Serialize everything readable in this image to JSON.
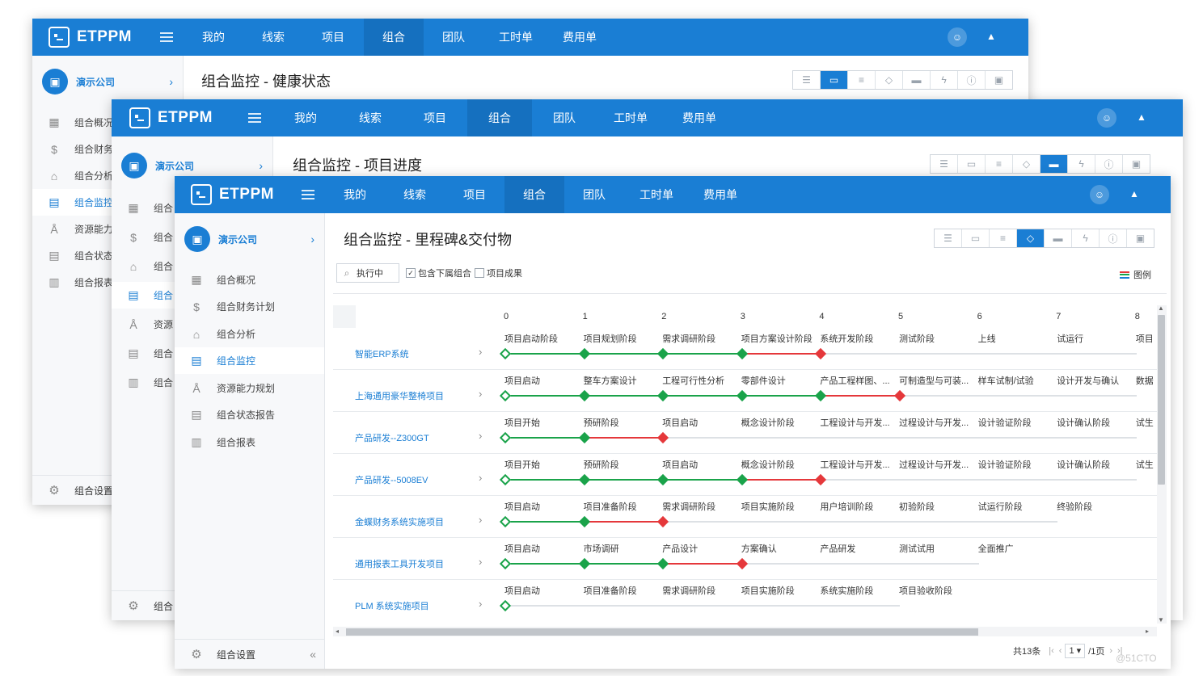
{
  "app": {
    "logo_text": "ETPPM",
    "nav": [
      "我的",
      "线索",
      "项目",
      "组合",
      "团队",
      "工时单",
      "费用单"
    ],
    "active_nav": "组合",
    "company": "演示公司"
  },
  "windows": {
    "back": {
      "title": "组合监控 - 健康状态",
      "sidebar": [
        "组合概况",
        "组合财务计划",
        "组合分析",
        "组合监控",
        "资源能力规划",
        "组合状态报告",
        "组合报表"
      ],
      "sidebar_visible": [
        "组合概况",
        "组合财务",
        "组合分析",
        "组合监控",
        "资源能力",
        "组合状态",
        "组合报表"
      ],
      "footer": "组合设置"
    },
    "middle": {
      "title": "组合监控 - 项目进度",
      "sidebar_visible": [
        "组合",
        "组合",
        "组合",
        "组合",
        "资源",
        "组合",
        "组合"
      ],
      "footer": "组合"
    },
    "front": {
      "title": "组合监控 - 里程碑&交付物",
      "sidebar": [
        "组合概况",
        "组合财务计划",
        "组合分析",
        "组合监控",
        "资源能力规划",
        "组合状态报告",
        "组合报表"
      ],
      "active_sidebar": "组合监控",
      "footer": "组合设置"
    }
  },
  "filters": {
    "status": "执行中",
    "include_sub": "包含下属组合",
    "include_sub_checked": true,
    "project_result": "项目成果",
    "project_result_checked": false
  },
  "legend_label": "图例",
  "timeline": {
    "ticks": [
      "0",
      "1",
      "2",
      "3",
      "4",
      "5",
      "6",
      "7",
      "8"
    ],
    "projects": [
      {
        "name": "智能ERP系统",
        "milestones": [
          {
            "label": "项目启动阶段",
            "status": "current"
          },
          {
            "label": "项目规划阶段",
            "status": "done"
          },
          {
            "label": "需求调研阶段",
            "status": "done"
          },
          {
            "label": "项目方案设计阶段",
            "status": "done"
          },
          {
            "label": "系统开发阶段",
            "status": "late"
          },
          {
            "label": "测试阶段",
            "status": "future"
          },
          {
            "label": "上线",
            "status": "future"
          },
          {
            "label": "试运行",
            "status": "future"
          },
          {
            "label": "项目",
            "status": "future"
          }
        ]
      },
      {
        "name": "上海通用豪华整椅项目",
        "milestones": [
          {
            "label": "项目启动",
            "status": "current"
          },
          {
            "label": "整车方案设计",
            "status": "done"
          },
          {
            "label": "工程可行性分析",
            "status": "done"
          },
          {
            "label": "零部件设计",
            "status": "done"
          },
          {
            "label": "产品工程样图、...",
            "status": "done"
          },
          {
            "label": "可制造型与可装...",
            "status": "late"
          },
          {
            "label": "样车试制/试验",
            "status": "future"
          },
          {
            "label": "设计开发与确认",
            "status": "future"
          },
          {
            "label": "数据",
            "status": "future"
          }
        ]
      },
      {
        "name": "产品研发--Z300GT",
        "milestones": [
          {
            "label": "项目开始",
            "status": "current"
          },
          {
            "label": "预研阶段",
            "status": "done"
          },
          {
            "label": "项目启动",
            "status": "late"
          },
          {
            "label": "概念设计阶段",
            "status": "future"
          },
          {
            "label": "工程设计与开发...",
            "status": "future"
          },
          {
            "label": "过程设计与开发...",
            "status": "future"
          },
          {
            "label": "设计验证阶段",
            "status": "future"
          },
          {
            "label": "设计确认阶段",
            "status": "future"
          },
          {
            "label": "试生",
            "status": "future"
          }
        ]
      },
      {
        "name": "产品研发--5008EV",
        "milestones": [
          {
            "label": "项目开始",
            "status": "current"
          },
          {
            "label": "预研阶段",
            "status": "done"
          },
          {
            "label": "项目启动",
            "status": "done"
          },
          {
            "label": "概念设计阶段",
            "status": "done"
          },
          {
            "label": "工程设计与开发...",
            "status": "late"
          },
          {
            "label": "过程设计与开发...",
            "status": "future"
          },
          {
            "label": "设计验证阶段",
            "status": "future"
          },
          {
            "label": "设计确认阶段",
            "status": "future"
          },
          {
            "label": "试生",
            "status": "future"
          }
        ]
      },
      {
        "name": "金蝶财务系统实施项目",
        "milestones": [
          {
            "label": "项目启动",
            "status": "current"
          },
          {
            "label": "项目准备阶段",
            "status": "done"
          },
          {
            "label": "需求调研阶段",
            "status": "late"
          },
          {
            "label": "项目实施阶段",
            "status": "future"
          },
          {
            "label": "用户培训阶段",
            "status": "future"
          },
          {
            "label": "初验阶段",
            "status": "future"
          },
          {
            "label": "试运行阶段",
            "status": "future"
          },
          {
            "label": "终验阶段",
            "status": "future"
          }
        ]
      },
      {
        "name": "通用报表工具开发项目",
        "milestones": [
          {
            "label": "项目启动",
            "status": "current"
          },
          {
            "label": "市场调研",
            "status": "done"
          },
          {
            "label": "产品设计",
            "status": "done"
          },
          {
            "label": "方案确认",
            "status": "late"
          },
          {
            "label": "产品研发",
            "status": "future"
          },
          {
            "label": "测试试用",
            "status": "future"
          },
          {
            "label": "全面推广",
            "status": "future"
          }
        ]
      },
      {
        "name": "PLM 系统实施项目",
        "milestones": [
          {
            "label": "项目启动",
            "status": "current"
          },
          {
            "label": "项目准备阶段",
            "status": "future"
          },
          {
            "label": "需求调研阶段",
            "status": "future"
          },
          {
            "label": "项目实施阶段",
            "status": "future"
          },
          {
            "label": "系统实施阶段",
            "status": "future"
          },
          {
            "label": "项目验收阶段",
            "status": "future"
          }
        ]
      }
    ]
  },
  "pager": {
    "total": "共13条",
    "page": "1",
    "pages": "/1页"
  },
  "colors": {
    "primary": "#1a7ed4",
    "done": "#1aa34a",
    "late": "#e5383b",
    "future": "#dde1e5"
  },
  "watermark": "@51CTO"
}
